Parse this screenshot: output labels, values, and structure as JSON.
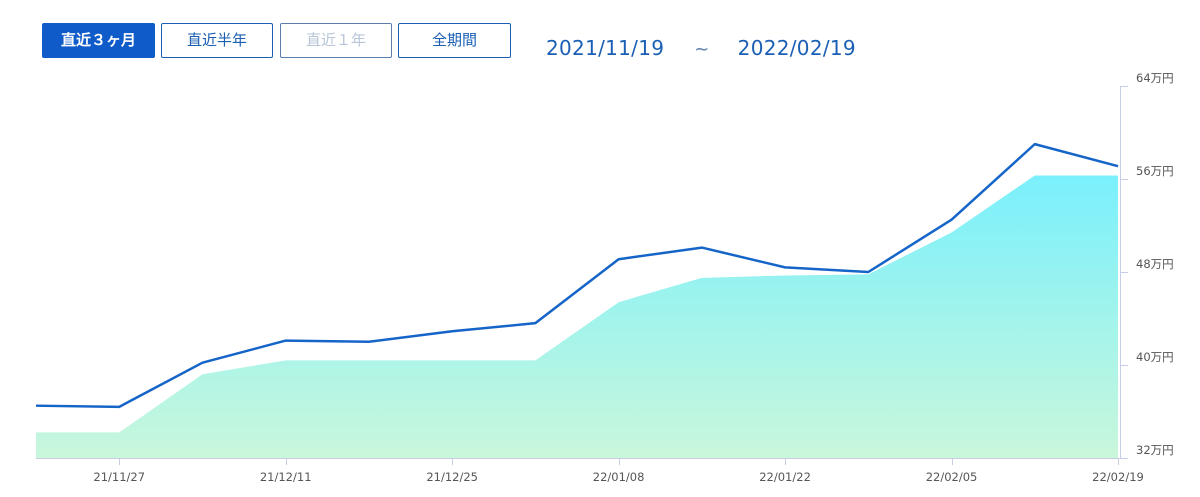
{
  "tabs": [
    {
      "label": "直近３ヶ月",
      "state": "active"
    },
    {
      "label": "直近半年",
      "state": "normal"
    },
    {
      "label": "直近１年",
      "state": "disabled"
    },
    {
      "label": "全期間",
      "state": "normal"
    }
  ],
  "date_range": {
    "start": "2021/11/19",
    "separator": "~",
    "end": "2022/02/19"
  },
  "colors": {
    "accent": "#0e5bc9",
    "line": "#1565c8",
    "area_top": "#7af0fc",
    "area_bottom": "#c9f7dc",
    "axis": "#c8cde6"
  },
  "chart_data": {
    "type": "area",
    "x": [
      "2021-11-20",
      "2021-11-27",
      "2021-12-04",
      "2021-12-11",
      "2021-12-18",
      "2021-12-25",
      "2022-01-01",
      "2022-01-08",
      "2022-01-15",
      "2022-01-22",
      "2022-01-29",
      "2022-02-05",
      "2022-02-12",
      "2022-02-19"
    ],
    "x_tick_labels": [
      "21/11/27",
      "21/12/11",
      "21/12/25",
      "22/01/08",
      "22/01/22",
      "22/02/05",
      "22/02/19"
    ],
    "x_ticks": [
      "2021-11-27",
      "2021-12-11",
      "2021-12-25",
      "2022-01-08",
      "2022-01-22",
      "2022-02-05",
      "2022-02-19"
    ],
    "y_unit": "万円",
    "y_tick_labels": [
      "32万円",
      "40万円",
      "48万円",
      "56万円",
      "64万円"
    ],
    "y_ticks": [
      32,
      40,
      48,
      56,
      64
    ],
    "ylim": [
      32,
      64
    ],
    "y_axis_position": "right",
    "grid": false,
    "series": [
      {
        "type": "line",
        "values": [
          36.5,
          36.4,
          40.2,
          42.1,
          42.0,
          42.9,
          43.6,
          49.1,
          50.1,
          48.4,
          48.0,
          52.5,
          59.0,
          57.1
        ]
      },
      {
        "type": "area",
        "values": [
          34.2,
          34.2,
          39.2,
          40.4,
          40.4,
          40.4,
          40.4,
          45.4,
          47.5,
          47.7,
          47.8,
          51.4,
          56.3,
          56.3
        ]
      }
    ]
  }
}
